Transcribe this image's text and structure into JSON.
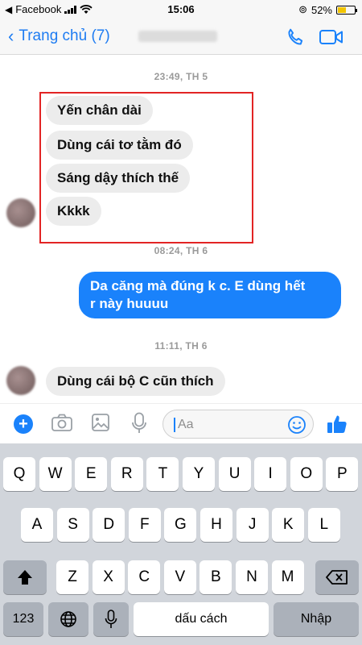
{
  "status_bar": {
    "app": "Facebook",
    "time": "15:06",
    "battery": "52%",
    "battery_level": 0.52
  },
  "nav": {
    "back_label": "Trang chủ (7)"
  },
  "chat": {
    "timestamp_1": "23:49, TH 5",
    "msg_1": "Yến chân dài",
    "msg_2": "Dùng cái tơ tằm đó",
    "msg_3": "Sáng dậy thích thế",
    "msg_4": "Kkkk",
    "timestamp_2": "08:24, TH 6",
    "out_line_1": "Da căng mà đúng k c. E dùng hết",
    "out_line_2": "r này huuuu",
    "timestamp_3": "11:11, TH 6",
    "msg_5": "Dùng cái bộ C cũn thích"
  },
  "composer": {
    "placeholder": "Aa"
  },
  "keyboard": {
    "row1": [
      "Q",
      "W",
      "E",
      "R",
      "T",
      "Y",
      "U",
      "I",
      "O",
      "P"
    ],
    "row2": [
      "A",
      "S",
      "D",
      "F",
      "G",
      "H",
      "J",
      "K",
      "L"
    ],
    "row3": [
      "Z",
      "X",
      "C",
      "V",
      "B",
      "N",
      "M"
    ],
    "numbers_label": "123",
    "space_label": "dấu cách",
    "return_label": "Nhập"
  },
  "colors": {
    "accent": "#1a82fb",
    "highlight_box": "#e22424",
    "incoming_bubble": "#ececec"
  }
}
